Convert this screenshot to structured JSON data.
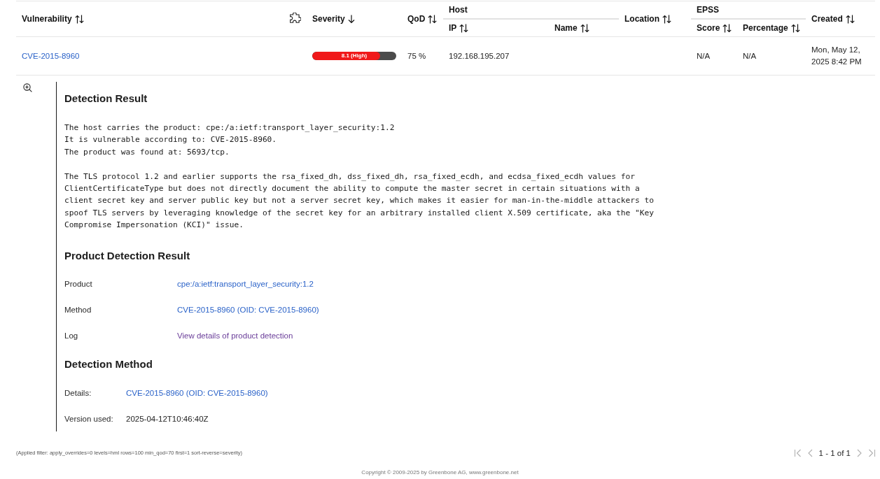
{
  "table": {
    "columns": [
      {
        "kind": "sortable",
        "label": "Vulnerability",
        "sorted_descending": false
      },
      {
        "kind": "icon"
      },
      {
        "kind": "sortable",
        "label": "Severity",
        "sorted_descending": true
      },
      {
        "kind": "sortable",
        "label": "QoD",
        "sorted_descending": false
      },
      {
        "kind": "group",
        "label": "Host",
        "children": [
          {
            "label": "IP",
            "sorted_descending": false
          },
          {
            "label": "Name",
            "sorted_descending": false
          }
        ]
      },
      {
        "kind": "sortable",
        "label": "Location",
        "sorted_descending": false
      },
      {
        "kind": "group",
        "label": "EPSS",
        "children": [
          {
            "label": "Score",
            "sorted_descending": false
          },
          {
            "label": "Percentage",
            "sorted_descending": false
          }
        ]
      },
      {
        "kind": "sortable",
        "label": "Created",
        "sorted_descending": false
      }
    ],
    "rows": [
      {
        "vulnerability": "CVE-2015-8960",
        "severity": {
          "level": 0.81,
          "label": "8.1 (High)"
        },
        "qod": "75 %",
        "ip": "192.168.195.207",
        "epss_score": "N/A",
        "epss_percentage": "N/A",
        "created": "Mon, May 12, 2025 8:42 PM",
        "expanded": true,
        "details": {
          "sections": [
            {
              "kind": "text",
              "title": "Detection Result",
              "paragraphs": [
                "The host carries the product: cpe:/a:ietf:transport_layer_security:1.2\nIt is vulnerable according to: CVE-2015-8960.\nThe product was found at: 5693/tcp.",
                "The TLS protocol 1.2 and earlier supports the rsa_fixed_dh, dss_fixed_dh, rsa_fixed_ecdh, and ecdsa_fixed_ecdh values for\nClientCertificateType but does not directly document the ability to compute the master secret in certain situations with a\nclient secret key and server public key but not a server secret key, which makes it easier for man-in-the-middle attackers to\nspoof TLS servers by leveraging knowledge of the secret key for an arbitrary installed client X.509 certificate, aka the \"Key\nCompromise Impersonation (KCI)\" issue."
              ]
            },
            {
              "kind": "table",
              "title": "Product Detection Result",
              "rows": [
                {
                  "label": "Product",
                  "kind": "link",
                  "value": "cpe:/a:ietf:transport_layer_security:1.2",
                  "visited": false
                },
                {
                  "label": "Method",
                  "kind": "link",
                  "value": "CVE-2015-8960 (OID: CVE-2015-8960)",
                  "visited": false
                },
                {
                  "label": "Log",
                  "kind": "link",
                  "value": "View details of product detection",
                  "visited": true
                }
              ]
            },
            {
              "kind": "compact_table",
              "title": "Detection Method",
              "rows": [
                {
                  "label": "Details:",
                  "kind": "link",
                  "value": "CVE-2015-8960 (OID: CVE-2015-8960)",
                  "visited": false
                },
                {
                  "label": "Version used:",
                  "kind": "text",
                  "value": "2025-04-12T10:46:40Z"
                }
              ]
            }
          ]
        }
      }
    ]
  },
  "footer": {
    "applied_filter": "(Applied filter: apply_overrides=0 levels=hml rows=100 min_qod=70 first=1 sort-reverse=severity)",
    "pagination": [
      {
        "kind": "first",
        "disabled": true
      },
      {
        "kind": "previous",
        "disabled": true
      },
      {
        "kind": "label",
        "text": "1 - 1 of 1"
      },
      {
        "kind": "next",
        "disabled": true
      },
      {
        "kind": "last",
        "disabled": true
      }
    ],
    "copyright": "Copyright © 2009-2025 by Greenbone AG, www.greenbone.net"
  }
}
